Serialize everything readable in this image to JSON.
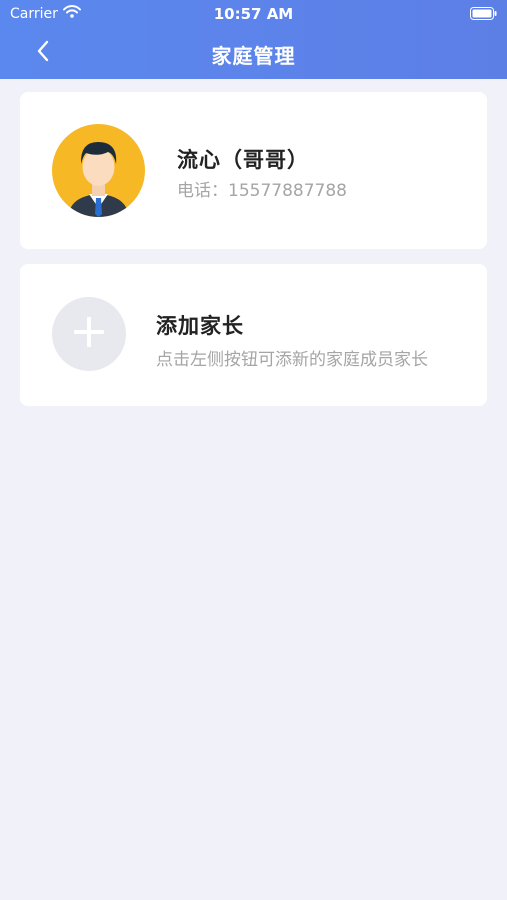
{
  "status_bar": {
    "carrier": "Carrier",
    "time": "10:57 AM"
  },
  "nav": {
    "title": "家庭管理"
  },
  "member": {
    "name": "流心（哥哥）",
    "phone": "电话：15577887788"
  },
  "add_parent": {
    "title": "添加家长",
    "description": "点击左侧按钮可添新的家庭成员家长"
  },
  "colors": {
    "header": "#5b88ee",
    "background": "#f1f2f9",
    "avatar_bg": "#f7b826",
    "muted_text": "#a5a5a5"
  },
  "icons": [
    "wifi-icon",
    "battery-icon",
    "back-chevron-icon",
    "avatar-icon",
    "plus-icon"
  ]
}
